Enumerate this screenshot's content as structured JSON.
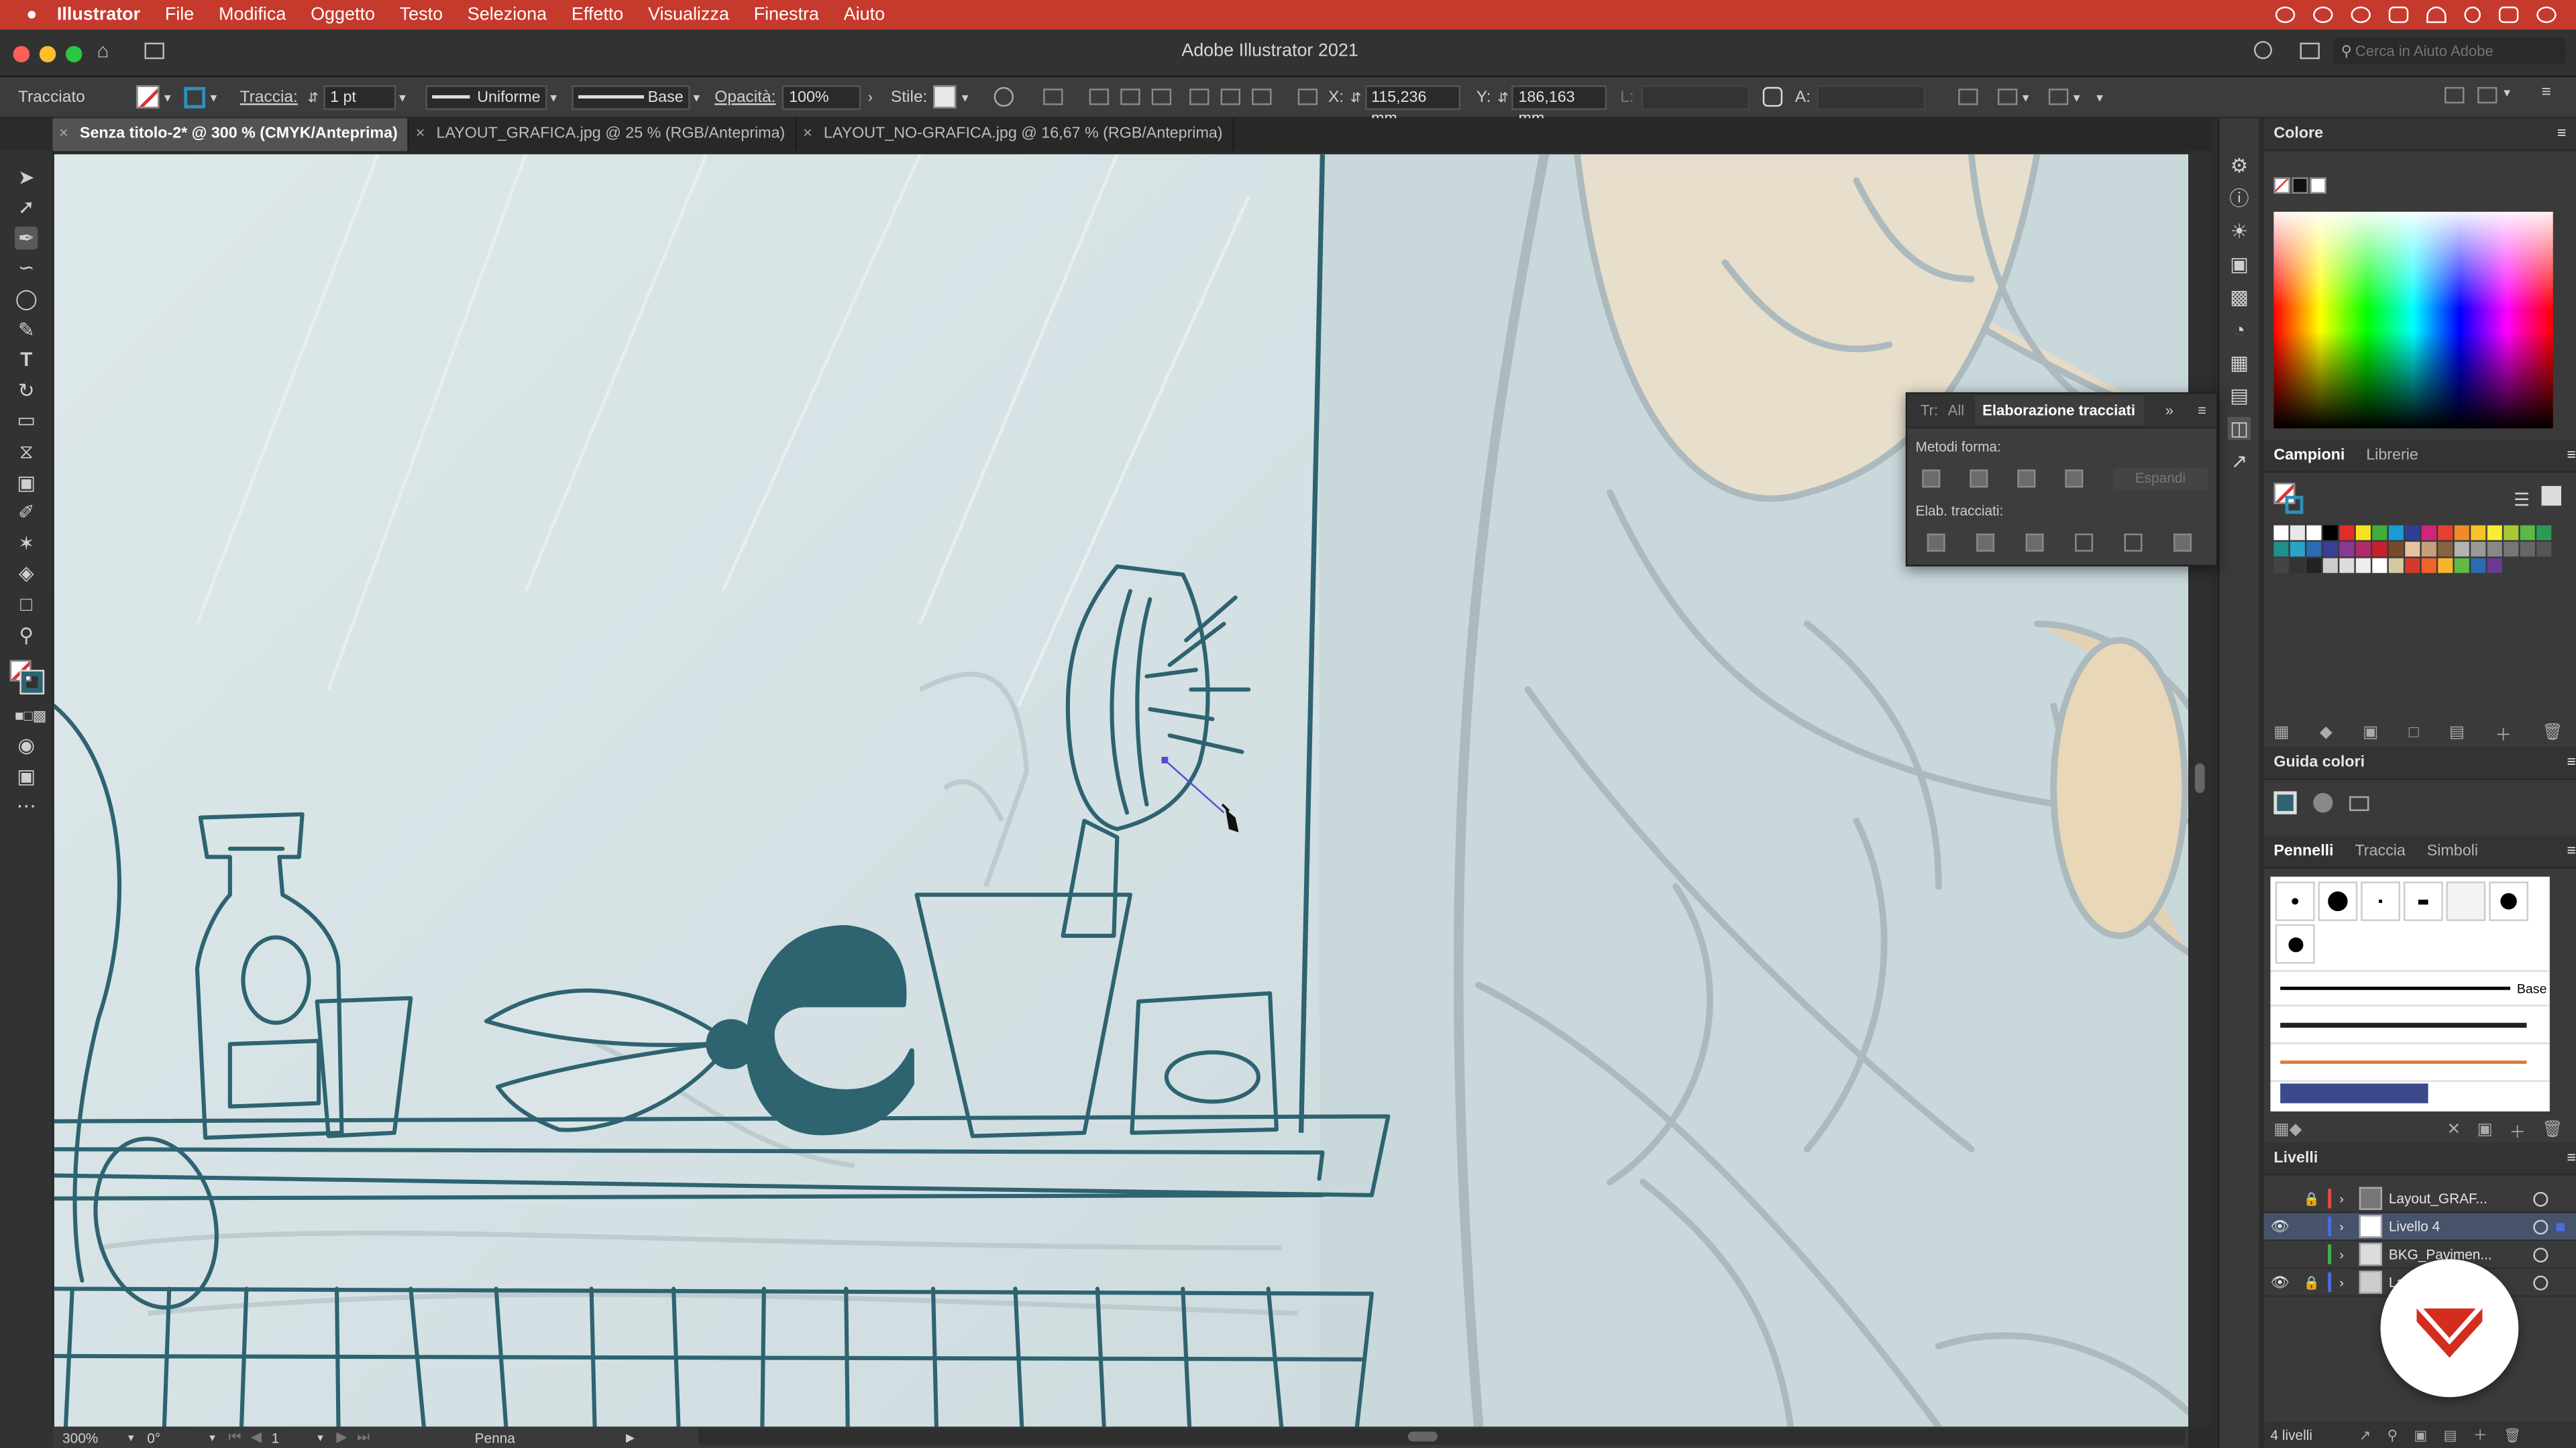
{
  "menubar": {
    "apple_icon": "apple-icon",
    "app_name": "Illustrator",
    "items": [
      "File",
      "Modifica",
      "Oggetto",
      "Testo",
      "Seleziona",
      "Effetto",
      "Visualizza",
      "Finestra",
      "Aiuto"
    ]
  },
  "window": {
    "title": "Adobe Illustrator 2021"
  },
  "control_bar": {
    "selection_label": "Tracciato",
    "stroke_label": "Traccia:",
    "stroke_weight": "1 pt",
    "profile_value": "Uniforme",
    "brush_value": "Base",
    "opacity_label": "Opacità:",
    "opacity_value": "100%",
    "style_label": "Stile:",
    "x_label": "X:",
    "x_value": "115,236 mm",
    "y_label": "Y:",
    "y_value": "186,163 mm",
    "l_label": "L:",
    "a_label": "A:",
    "search_placeholder": "Cerca in Aiuto Adobe"
  },
  "tabs": [
    {
      "label": "Senza titolo-2* @ 300 % (CMYK/Anteprima)",
      "active": true
    },
    {
      "label": "LAYOUT_GRAFICA.jpg @ 25 % (RGB/Anteprima)",
      "active": false
    },
    {
      "label": "LAYOUT_NO-GRAFICA.jpg @ 16,67 % (RGB/Anteprima)",
      "active": false
    }
  ],
  "status_bar": {
    "zoom": "300%",
    "rotation": "0°",
    "artboard": "1",
    "tool": "Penna"
  },
  "color_panel": {
    "title": "Colore"
  },
  "swatches_panel": {
    "tabs": [
      "Campioni",
      "Librerie"
    ]
  },
  "color_guide_panel": {
    "title": "Guida colori"
  },
  "brushes_panel": {
    "tabs": [
      "Pennelli",
      "Traccia",
      "Simboli"
    ],
    "base_label": "Base"
  },
  "layers_panel": {
    "title": "Livelli",
    "layers": [
      {
        "name": "Layout_GRAF...",
        "color": "#e04a4a"
      },
      {
        "name": "Livello 4",
        "color": "#4a6ee0"
      },
      {
        "name": "BKG_Pavimen...",
        "color": "#3fb54a"
      },
      {
        "name": "La...",
        "color": "#4a6ee0"
      }
    ],
    "count": "4 livelli"
  },
  "pathfinder_panel": {
    "tabs": [
      "Tr:",
      "All",
      "Elaborazione tracciati"
    ],
    "shape_modes_label": "Metodi forma:",
    "expand_label": "Espandi",
    "pathfinders_label": "Elab. tracciati:"
  },
  "colors": {
    "accent": "#c63a2d",
    "artwork_stroke": "#2e6370",
    "canvas_bg": "#d3e0e2",
    "sketch_skin": "#f0c896"
  }
}
